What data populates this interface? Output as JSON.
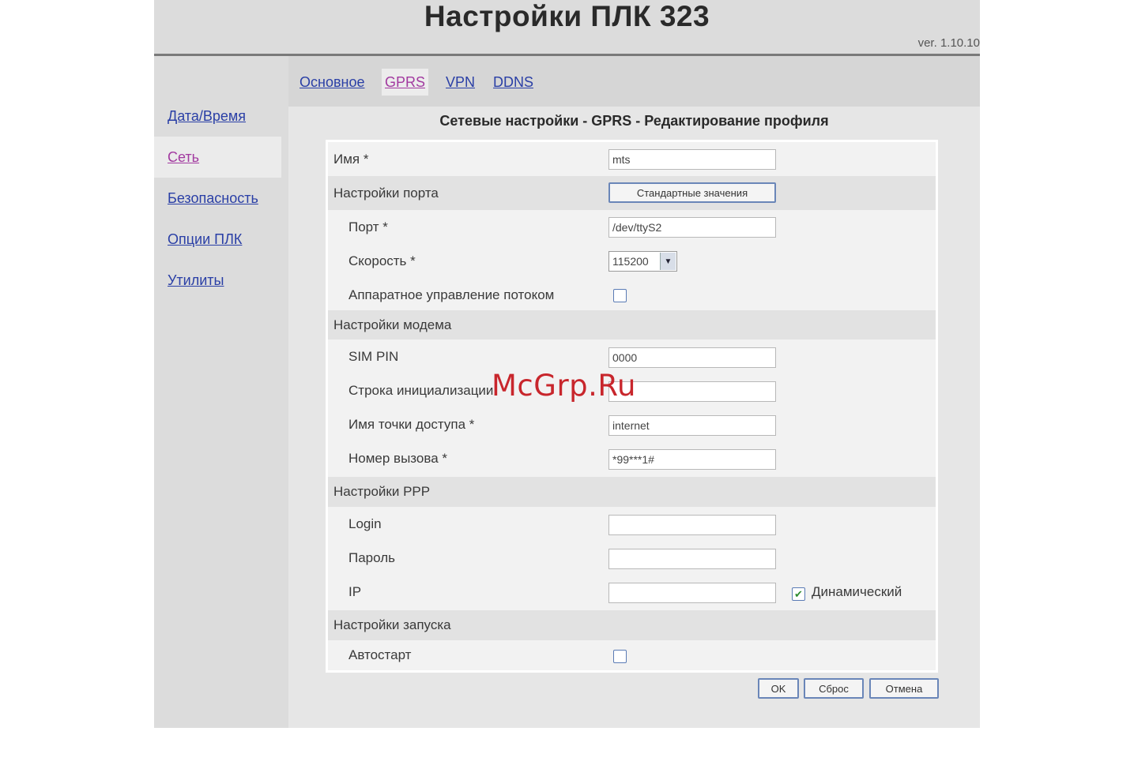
{
  "header": {
    "title": "Настройки ПЛК 323",
    "version": "ver. 1.10.10"
  },
  "sidebar": {
    "items": [
      {
        "label": "Дата/Время"
      },
      {
        "label": "Сеть"
      },
      {
        "label": "Безопасность"
      },
      {
        "label": "Опции ПЛК"
      },
      {
        "label": "Утилиты"
      }
    ],
    "active_index": 1
  },
  "tabs": {
    "items": [
      {
        "label": "Основное"
      },
      {
        "label": "GPRS"
      },
      {
        "label": "VPN"
      },
      {
        "label": "DDNS"
      }
    ],
    "active_index": 1
  },
  "section_title": "Сетевые настройки - GPRS - Редактирование профиля",
  "form": {
    "name_label": "Имя *",
    "name_value": "mts",
    "port_group_label": "Настройки порта",
    "defaults_button": "Стандартные значения",
    "port_label": "Порт *",
    "port_value": "/dev/ttyS2",
    "speed_label": "Скорость *",
    "speed_value": "115200",
    "flow_label": "Аппаратное управление потоком",
    "flow_checked": false,
    "modem_group_label": "Настройки модема",
    "simpin_label": "SIM PIN",
    "simpin_value": "0000",
    "init_label": "Строка инициализации",
    "init_value": "",
    "apn_label": "Имя точки доступа *",
    "apn_value": "internet",
    "dial_label": "Номер вызова *",
    "dial_value": "*99***1#",
    "ppp_group_label": "Настройки PPP",
    "login_label": "Login",
    "login_value": "",
    "password_label": "Пароль",
    "password_value": "",
    "ip_label": "IP",
    "ip_value": "",
    "dynamic_label": "Динамический",
    "dynamic_checked": true,
    "startup_group_label": "Настройки запуска",
    "autostart_label": "Автостарт",
    "autostart_checked": false
  },
  "buttons": {
    "ok": "OK",
    "reset": "Сброс",
    "cancel": "Отмена"
  },
  "watermark": "McGrp.Ru",
  "colors": {
    "link": "#2a3fa6",
    "visited_link": "#a23aa0",
    "watermark": "#c8262c"
  }
}
